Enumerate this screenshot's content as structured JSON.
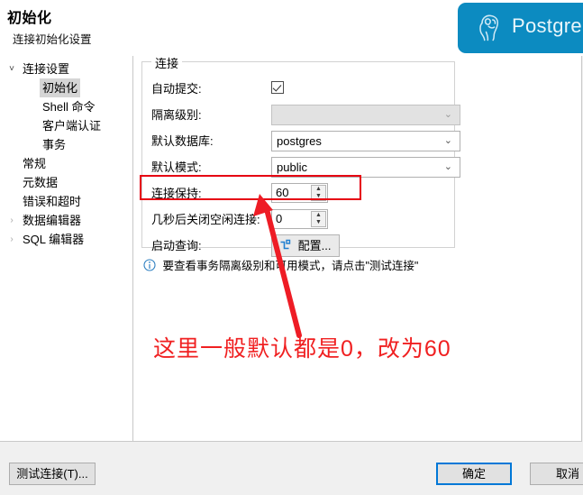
{
  "header": {
    "title": "初始化",
    "subtitle": "连接初始化设置",
    "brand_text": "PostgreS",
    "brand_color": "#0c8bc1",
    "logo_icon": "postgresql-elephant-icon"
  },
  "sidebar": {
    "items": [
      {
        "label": "连接设置",
        "level": 0,
        "twisty": "expanded",
        "twisty_glyph": "˅",
        "selected": false
      },
      {
        "label": "初始化",
        "level": 1,
        "twisty": "none",
        "twisty_glyph": "",
        "selected": true
      },
      {
        "label": "Shell 命令",
        "level": 1,
        "twisty": "none",
        "twisty_glyph": "",
        "selected": false
      },
      {
        "label": "客户端认证",
        "level": 1,
        "twisty": "none",
        "twisty_glyph": "",
        "selected": false
      },
      {
        "label": "事务",
        "level": 1,
        "twisty": "none",
        "twisty_glyph": "",
        "selected": false
      },
      {
        "label": "常规",
        "level": 0,
        "twisty": "none",
        "twisty_glyph": "",
        "selected": false
      },
      {
        "label": "元数据",
        "level": 0,
        "twisty": "none",
        "twisty_glyph": "",
        "selected": false
      },
      {
        "label": "错误和超时",
        "level": 0,
        "twisty": "none",
        "twisty_glyph": "",
        "selected": false
      },
      {
        "label": "数据编辑器",
        "level": 0,
        "twisty": "collapsed",
        "twisty_glyph": "›",
        "selected": false
      },
      {
        "label": "SQL 编辑器",
        "level": 0,
        "twisty": "collapsed",
        "twisty_glyph": "›",
        "selected": false
      }
    ]
  },
  "form": {
    "group_title": "连接",
    "autocommit": {
      "label": "自动提交:",
      "checked": true
    },
    "isolation_level": {
      "label": "隔离级别:",
      "value": "",
      "disabled": true,
      "chevron": "⌄"
    },
    "default_database": {
      "label": "默认数据库:",
      "value": "postgres",
      "chevron": "⌄"
    },
    "default_schema": {
      "label": "默认模式:",
      "value": "public",
      "chevron": "⌄"
    },
    "keep_alive": {
      "label": "连接保持:",
      "value": "60",
      "up": "▲",
      "down": "▼"
    },
    "close_idle": {
      "label": "几秒后关闭空闲连接:",
      "value": "0",
      "up": "▲",
      "down": "▼"
    },
    "bootstrap_queries": {
      "label": "启动查询:",
      "button_label": "配置...",
      "button_icon": "configure-icon"
    },
    "note": {
      "icon": "info-icon",
      "text": "要查看事务隔离级别和可用模式，请点击\"测试连接\""
    }
  },
  "annotations": {
    "highlight_color": "#e60012",
    "arrow_color": "#ee1c25",
    "text": "这里一般默认都是0，改为60",
    "text_color": "#f02021"
  },
  "footer": {
    "test_connection_label": "测试连接(T)...",
    "ok_label": "确定",
    "cancel_label": "取消",
    "focus_color": "#0078d7"
  }
}
